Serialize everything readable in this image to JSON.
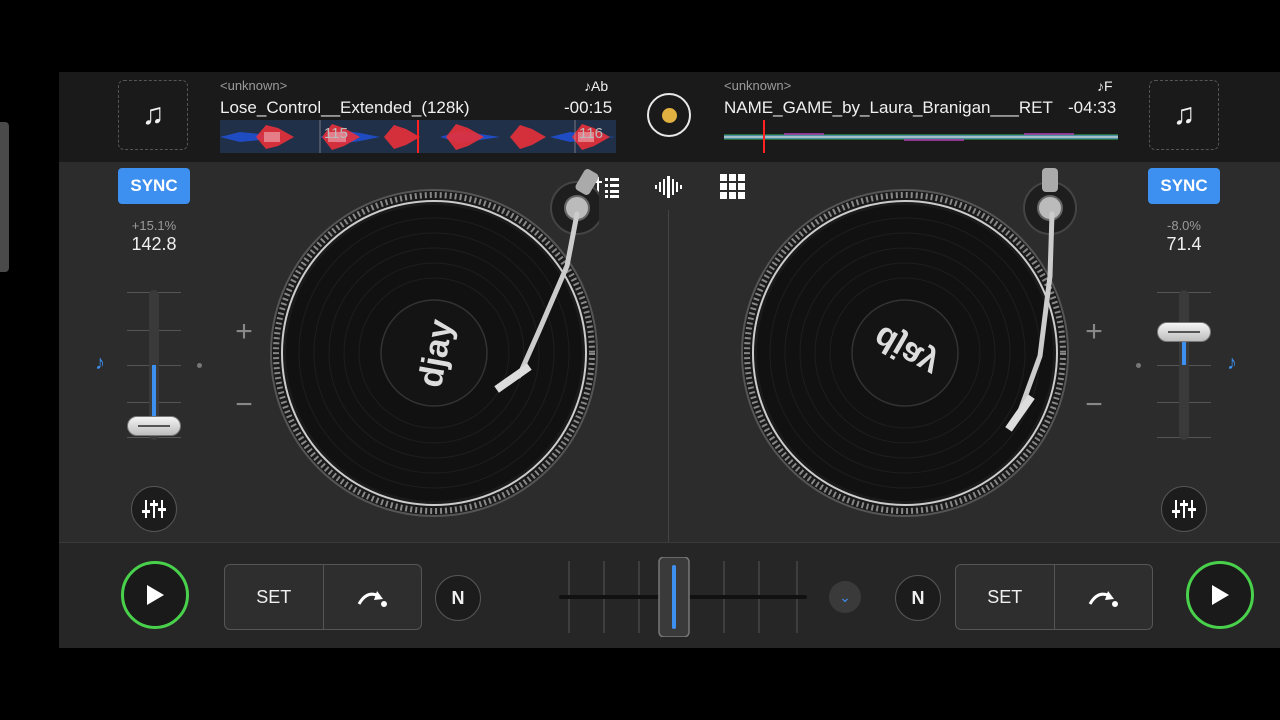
{
  "deck_a": {
    "artist": "<unknown>",
    "title": "Lose_Control__Extended_(128k)",
    "key": "♪Ab",
    "time": "-00:15",
    "beat_markers": [
      "115",
      "116"
    ],
    "sync_label": "SYNC",
    "pitch_percent": "+15.1%",
    "bpm": "142.8",
    "plus": "+",
    "minus": "−",
    "cue_set": "SET",
    "key_lock": "N",
    "pitch_slider_level": 0.15
  },
  "deck_b": {
    "artist": "<unknown>",
    "title": "NAME_GAME_by_Laura_Branigan___RET",
    "key": "♪F",
    "time": "-04:33",
    "sync_label": "SYNC",
    "pitch_percent": "-8.0%",
    "bpm": "71.4",
    "plus": "+",
    "minus": "−",
    "cue_set": "SET",
    "key_lock": "N",
    "pitch_slider_level": -0.08
  },
  "icons": {
    "cover": "♫",
    "note": "♪",
    "play": "play-icon",
    "loop": "loop-arrow-icon",
    "eq": "mixer-sliders-icon",
    "chevron": "⌄"
  },
  "crossfader_position": 0.5,
  "colors": {
    "accent": "#3d8ff0",
    "play_ring": "#49d14b",
    "record_center": "#e0b040"
  }
}
